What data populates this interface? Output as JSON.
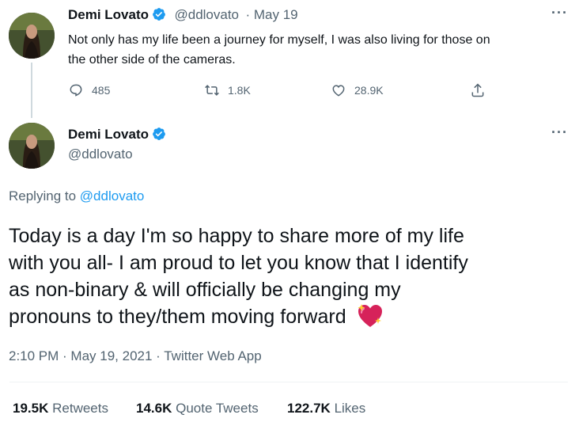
{
  "first_tweet": {
    "name": "Demi Lovato",
    "handle": "@ddlovato",
    "date": "· May 19",
    "lines": [
      "Not only has my life been a journey for myself,  I was also living for those on",
      "the other side of the cameras."
    ],
    "actions": {
      "reply_count": "485",
      "retweet_count": "1.8K",
      "like_count": "28.9K"
    }
  },
  "main_tweet": {
    "name": "Demi Lovato",
    "handle": "@ddlovato",
    "replying_prefix": "Replying to",
    "replying_handle": "@ddlovato",
    "lines": [
      "Today is a day I'm so happy to share more of my life",
      "with you all- I am proud to let you know that I identify",
      "as non-binary & will officially be changing my",
      "pronouns to they/them moving forward"
    ],
    "timestamp": "2:10 PM · May 19, 2021 · Twitter Web App",
    "stats": {
      "retweets_value": "19.5K",
      "retweets_label": "Retweets",
      "quote_value": "14.6K",
      "quote_label": "Quote Tweets",
      "likes_value": "122.7K",
      "likes_label": "Likes"
    }
  },
  "colors": {
    "accent": "#1d9bf0",
    "secondary_text": "#536471",
    "primary_text": "#0f1419",
    "heart_emoji": "#d6225a"
  },
  "icons": [
    "verified-badge-icon",
    "more-icon",
    "reply-icon",
    "retweet-icon",
    "like-icon",
    "share-icon",
    "sparkling-heart-emoji"
  ]
}
